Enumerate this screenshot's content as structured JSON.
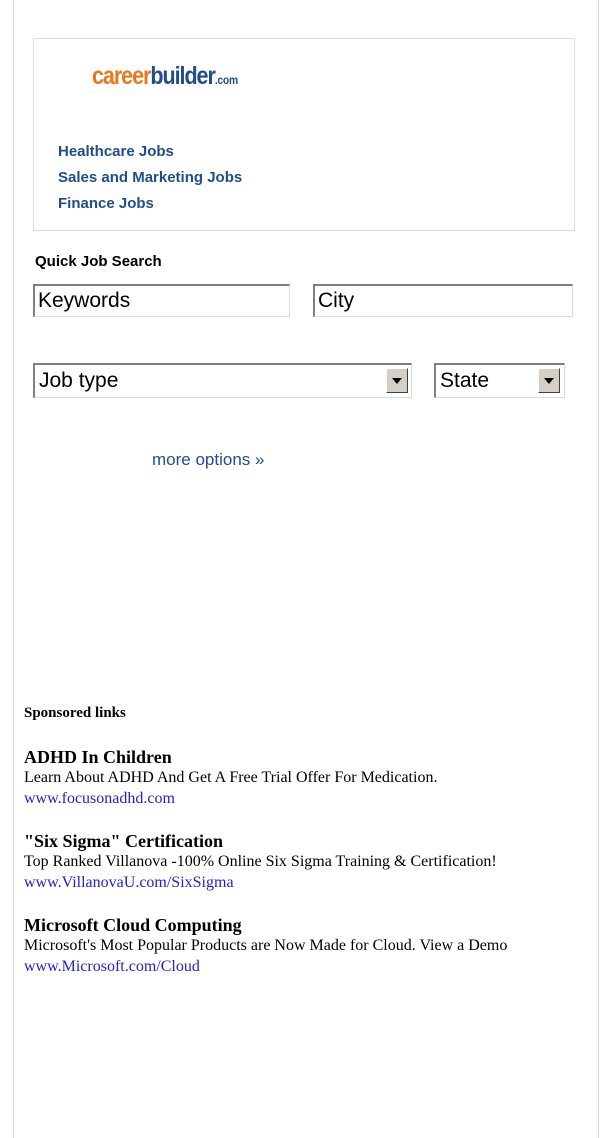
{
  "careerbuilder": {
    "logo_part1": "career",
    "logo_part2": "builder",
    "logo_suffix": ".com",
    "links": [
      "Healthcare Jobs",
      "Sales and Marketing Jobs",
      "Finance Jobs"
    ]
  },
  "quick_search": {
    "title": "Quick Job Search",
    "keywords_value": "Keywords",
    "city_value": "City",
    "job_type_selected": "Job type",
    "state_selected": "State",
    "more_options": "more options »"
  },
  "sponsored": {
    "title": "Sponsored links",
    "ads": [
      {
        "title": "ADHD In Children",
        "description": "Learn About ADHD And Get A Free Trial Offer For Medication.",
        "url": "www.focusonadhd.com"
      },
      {
        "title": "\"Six Sigma\" Certification",
        "description": "Top Ranked Villanova -100% Online Six Sigma Training & Certification!",
        "url": "www.VillanovaU.com/SixSigma"
      },
      {
        "title": "Microsoft Cloud Computing",
        "description": "Microsoft's Most Popular Products are Now Made for Cloud. View a Demo",
        "url": "www.Microsoft.com/Cloud"
      }
    ]
  },
  "colors": {
    "link_blue": "#1f4e89",
    "logo_orange": "#e8781e",
    "ad_url_blue": "#2222cc"
  }
}
